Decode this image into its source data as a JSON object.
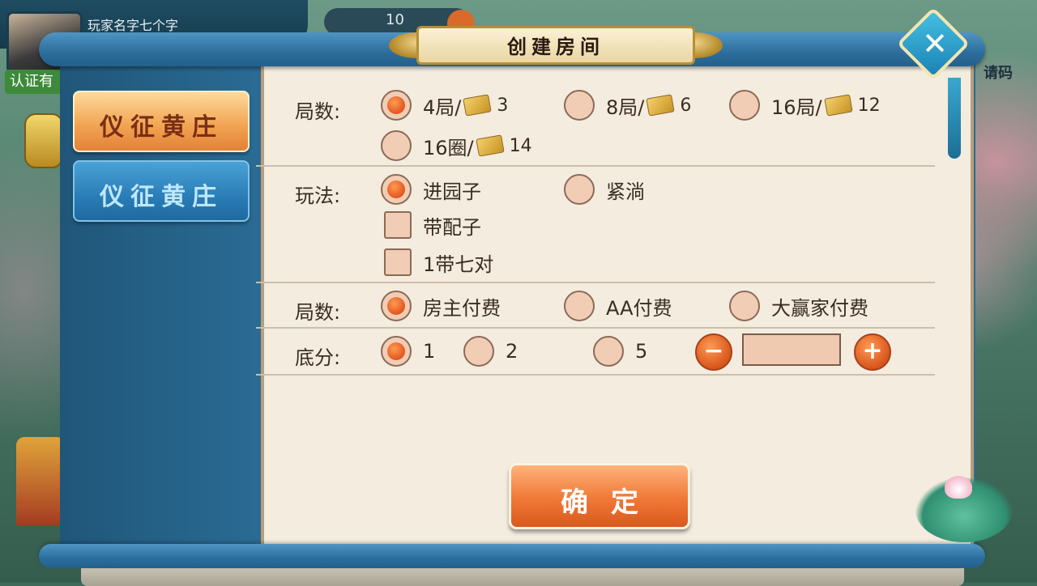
{
  "header": {
    "player_name": "玩家名字七个字",
    "verify_tag": "认证有",
    "coin_value": "10",
    "right_tag": "请码"
  },
  "dialog": {
    "title": "创建房间",
    "close_symbol": "✕",
    "tabs": [
      {
        "label": "仪征黄庄",
        "active": true
      },
      {
        "label": "仪征黄庄",
        "active": false
      }
    ],
    "rounds": {
      "label": "局数:",
      "options": [
        {
          "text": "4局/",
          "cost": "3",
          "selected": true
        },
        {
          "text": "8局/",
          "cost": "6",
          "selected": false
        },
        {
          "text": "16局/",
          "cost": "12",
          "selected": false
        },
        {
          "text": "16圈/",
          "cost": "14",
          "selected": false
        }
      ]
    },
    "play": {
      "label": "玩法:",
      "options": [
        {
          "text": "进园子",
          "selected": true
        },
        {
          "text": "紧淌",
          "selected": false
        }
      ],
      "checkboxes": [
        {
          "text": "带配子",
          "checked": false
        },
        {
          "text": "1带七对",
          "checked": false
        }
      ]
    },
    "payment": {
      "label": "局数:",
      "options": [
        {
          "text": "房主付费",
          "selected": true
        },
        {
          "text": "AA付费",
          "selected": false
        },
        {
          "text": "大赢家付费",
          "selected": false
        }
      ]
    },
    "base_score": {
      "label": "底分:",
      "options": [
        {
          "text": "1",
          "selected": true
        },
        {
          "text": "2",
          "selected": false
        },
        {
          "text": "5",
          "selected": false
        }
      ],
      "minus_symbol": "−",
      "plus_symbol": "+",
      "custom_value": ""
    },
    "confirm_label": "确定"
  },
  "colors": {
    "accent_orange": "#e2571f",
    "panel_bg": "#f3ecdf",
    "scroll_blue": "#2c6d9c"
  }
}
